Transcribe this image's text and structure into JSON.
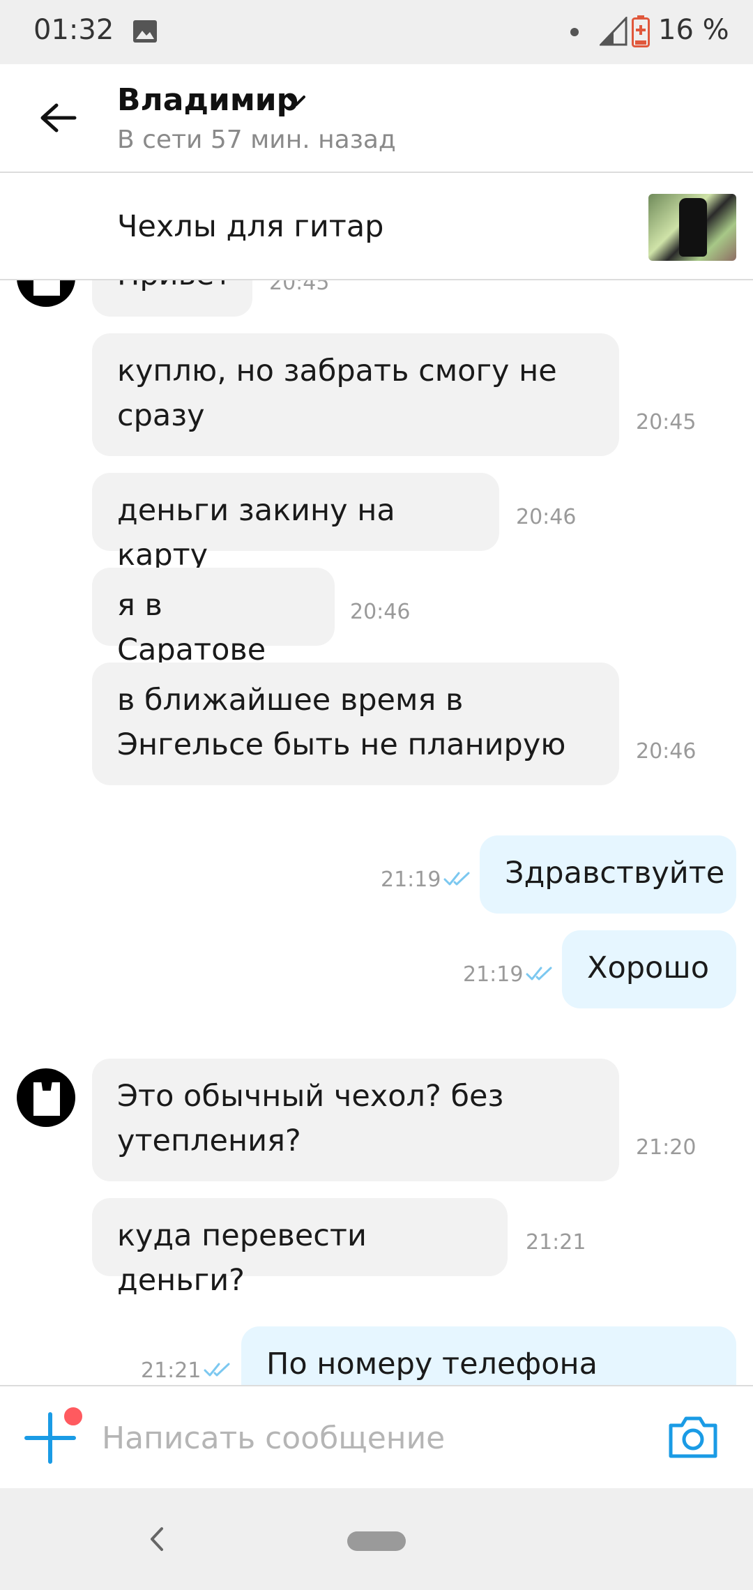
{
  "status_bar": {
    "time": "01:32",
    "battery": "16 %"
  },
  "header": {
    "name": "Владимир",
    "status": "В сети 57 мин. назад"
  },
  "listing": {
    "title": "Чехлы для гитар"
  },
  "messages": [
    {
      "text": "Привет",
      "time": "20:45",
      "dir": "in"
    },
    {
      "text": "куплю, но забрать смогу не сразу",
      "time": "20:45",
      "dir": "in"
    },
    {
      "text": "деньги закину на карту",
      "time": "20:46",
      "dir": "in"
    },
    {
      "text": "я в Саратове",
      "time": "20:46",
      "dir": "in"
    },
    {
      "text": "в ближайшее время в Энгельсе быть не планирую",
      "time": "20:46",
      "dir": "in"
    },
    {
      "text": "Здравствуйте",
      "time": "21:19",
      "dir": "out"
    },
    {
      "text": "Хорошо",
      "time": "21:19",
      "dir": "out"
    },
    {
      "text": "Это обычный чехол? без утепления?",
      "time": "21:20",
      "dir": "in"
    },
    {
      "text": "куда перевести деньги?",
      "time": "21:21",
      "dir": "in"
    },
    {
      "text": "По номеру телефона можете",
      "time": "21:21",
      "dir": "out"
    }
  ],
  "composer": {
    "placeholder": "Написать сообщение"
  },
  "colors": {
    "accent": "#1a9be5",
    "incoming_bubble": "#f2f2f2",
    "outgoing_bubble": "#e6f6ff",
    "notify_dot": "#ff5a5f",
    "read_ticks": "#7cc8f0"
  },
  "icons": [
    "image-icon",
    "signal-icon",
    "battery-icon",
    "back-arrow-icon",
    "chevron-down-icon",
    "plus-icon",
    "camera-icon",
    "nav-back-icon"
  ]
}
